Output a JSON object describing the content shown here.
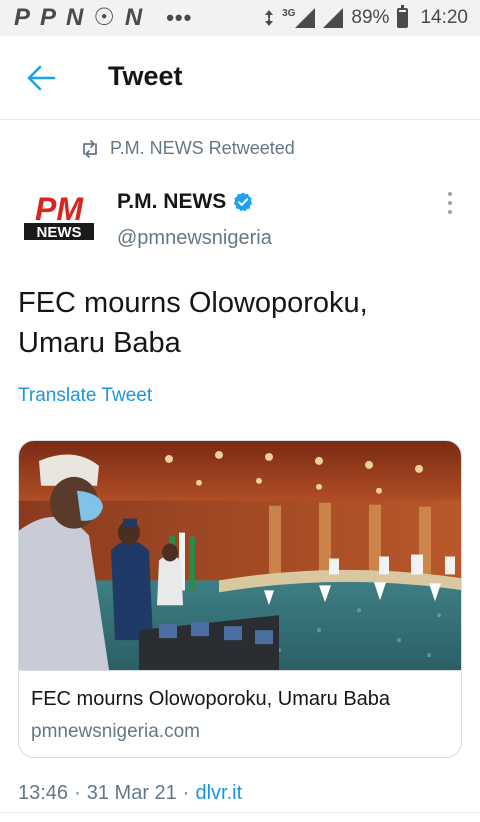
{
  "status_bar": {
    "notification_icons": [
      "P",
      "P",
      "N",
      "☉",
      "N"
    ],
    "overflow": "•••",
    "network": "3G",
    "battery": "89%",
    "battery_level": 0.89,
    "time": "14:20"
  },
  "header": {
    "title": "Tweet"
  },
  "retweet": {
    "text": "P.M. NEWS Retweeted"
  },
  "author": {
    "name": "P.M. NEWS",
    "handle": "@pmnewsnigeria",
    "avatar_text_top": "PM",
    "avatar_text_bottom": "NEWS"
  },
  "tweet": {
    "text": "FEC mourns Olowoporoku, Umaru Baba",
    "translate_label": "Translate Tweet"
  },
  "card": {
    "title": "FEC mourns Olowoporoku, Umaru Baba",
    "domain": "pmnewsnigeria.com"
  },
  "meta": {
    "time": "13:46",
    "separator": "·",
    "date": "31 Mar 21",
    "source": "dlvr.it"
  },
  "colors": {
    "accent": "#1b95e0",
    "muted": "#657786",
    "verified": "#1da1f2",
    "brand_red": "#d7261e"
  }
}
